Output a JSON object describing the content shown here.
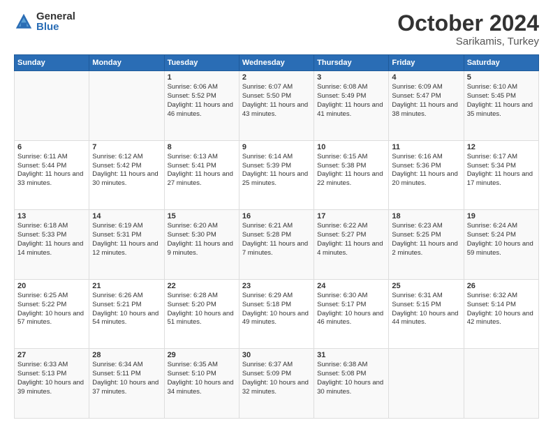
{
  "header": {
    "logo_general": "General",
    "logo_blue": "Blue",
    "title": "October 2024",
    "location": "Sarikamis, Turkey"
  },
  "calendar": {
    "days_of_week": [
      "Sunday",
      "Monday",
      "Tuesday",
      "Wednesday",
      "Thursday",
      "Friday",
      "Saturday"
    ],
    "weeks": [
      [
        {
          "day": "",
          "sunrise": "",
          "sunset": "",
          "daylight": ""
        },
        {
          "day": "",
          "sunrise": "",
          "sunset": "",
          "daylight": ""
        },
        {
          "day": "1",
          "sunrise": "Sunrise: 6:06 AM",
          "sunset": "Sunset: 5:52 PM",
          "daylight": "Daylight: 11 hours and 46 minutes."
        },
        {
          "day": "2",
          "sunrise": "Sunrise: 6:07 AM",
          "sunset": "Sunset: 5:50 PM",
          "daylight": "Daylight: 11 hours and 43 minutes."
        },
        {
          "day": "3",
          "sunrise": "Sunrise: 6:08 AM",
          "sunset": "Sunset: 5:49 PM",
          "daylight": "Daylight: 11 hours and 41 minutes."
        },
        {
          "day": "4",
          "sunrise": "Sunrise: 6:09 AM",
          "sunset": "Sunset: 5:47 PM",
          "daylight": "Daylight: 11 hours and 38 minutes."
        },
        {
          "day": "5",
          "sunrise": "Sunrise: 6:10 AM",
          "sunset": "Sunset: 5:45 PM",
          "daylight": "Daylight: 11 hours and 35 minutes."
        }
      ],
      [
        {
          "day": "6",
          "sunrise": "Sunrise: 6:11 AM",
          "sunset": "Sunset: 5:44 PM",
          "daylight": "Daylight: 11 hours and 33 minutes."
        },
        {
          "day": "7",
          "sunrise": "Sunrise: 6:12 AM",
          "sunset": "Sunset: 5:42 PM",
          "daylight": "Daylight: 11 hours and 30 minutes."
        },
        {
          "day": "8",
          "sunrise": "Sunrise: 6:13 AM",
          "sunset": "Sunset: 5:41 PM",
          "daylight": "Daylight: 11 hours and 27 minutes."
        },
        {
          "day": "9",
          "sunrise": "Sunrise: 6:14 AM",
          "sunset": "Sunset: 5:39 PM",
          "daylight": "Daylight: 11 hours and 25 minutes."
        },
        {
          "day": "10",
          "sunrise": "Sunrise: 6:15 AM",
          "sunset": "Sunset: 5:38 PM",
          "daylight": "Daylight: 11 hours and 22 minutes."
        },
        {
          "day": "11",
          "sunrise": "Sunrise: 6:16 AM",
          "sunset": "Sunset: 5:36 PM",
          "daylight": "Daylight: 11 hours and 20 minutes."
        },
        {
          "day": "12",
          "sunrise": "Sunrise: 6:17 AM",
          "sunset": "Sunset: 5:34 PM",
          "daylight": "Daylight: 11 hours and 17 minutes."
        }
      ],
      [
        {
          "day": "13",
          "sunrise": "Sunrise: 6:18 AM",
          "sunset": "Sunset: 5:33 PM",
          "daylight": "Daylight: 11 hours and 14 minutes."
        },
        {
          "day": "14",
          "sunrise": "Sunrise: 6:19 AM",
          "sunset": "Sunset: 5:31 PM",
          "daylight": "Daylight: 11 hours and 12 minutes."
        },
        {
          "day": "15",
          "sunrise": "Sunrise: 6:20 AM",
          "sunset": "Sunset: 5:30 PM",
          "daylight": "Daylight: 11 hours and 9 minutes."
        },
        {
          "day": "16",
          "sunrise": "Sunrise: 6:21 AM",
          "sunset": "Sunset: 5:28 PM",
          "daylight": "Daylight: 11 hours and 7 minutes."
        },
        {
          "day": "17",
          "sunrise": "Sunrise: 6:22 AM",
          "sunset": "Sunset: 5:27 PM",
          "daylight": "Daylight: 11 hours and 4 minutes."
        },
        {
          "day": "18",
          "sunrise": "Sunrise: 6:23 AM",
          "sunset": "Sunset: 5:25 PM",
          "daylight": "Daylight: 11 hours and 2 minutes."
        },
        {
          "day": "19",
          "sunrise": "Sunrise: 6:24 AM",
          "sunset": "Sunset: 5:24 PM",
          "daylight": "Daylight: 10 hours and 59 minutes."
        }
      ],
      [
        {
          "day": "20",
          "sunrise": "Sunrise: 6:25 AM",
          "sunset": "Sunset: 5:22 PM",
          "daylight": "Daylight: 10 hours and 57 minutes."
        },
        {
          "day": "21",
          "sunrise": "Sunrise: 6:26 AM",
          "sunset": "Sunset: 5:21 PM",
          "daylight": "Daylight: 10 hours and 54 minutes."
        },
        {
          "day": "22",
          "sunrise": "Sunrise: 6:28 AM",
          "sunset": "Sunset: 5:20 PM",
          "daylight": "Daylight: 10 hours and 51 minutes."
        },
        {
          "day": "23",
          "sunrise": "Sunrise: 6:29 AM",
          "sunset": "Sunset: 5:18 PM",
          "daylight": "Daylight: 10 hours and 49 minutes."
        },
        {
          "day": "24",
          "sunrise": "Sunrise: 6:30 AM",
          "sunset": "Sunset: 5:17 PM",
          "daylight": "Daylight: 10 hours and 46 minutes."
        },
        {
          "day": "25",
          "sunrise": "Sunrise: 6:31 AM",
          "sunset": "Sunset: 5:15 PM",
          "daylight": "Daylight: 10 hours and 44 minutes."
        },
        {
          "day": "26",
          "sunrise": "Sunrise: 6:32 AM",
          "sunset": "Sunset: 5:14 PM",
          "daylight": "Daylight: 10 hours and 42 minutes."
        }
      ],
      [
        {
          "day": "27",
          "sunrise": "Sunrise: 6:33 AM",
          "sunset": "Sunset: 5:13 PM",
          "daylight": "Daylight: 10 hours and 39 minutes."
        },
        {
          "day": "28",
          "sunrise": "Sunrise: 6:34 AM",
          "sunset": "Sunset: 5:11 PM",
          "daylight": "Daylight: 10 hours and 37 minutes."
        },
        {
          "day": "29",
          "sunrise": "Sunrise: 6:35 AM",
          "sunset": "Sunset: 5:10 PM",
          "daylight": "Daylight: 10 hours and 34 minutes."
        },
        {
          "day": "30",
          "sunrise": "Sunrise: 6:37 AM",
          "sunset": "Sunset: 5:09 PM",
          "daylight": "Daylight: 10 hours and 32 minutes."
        },
        {
          "day": "31",
          "sunrise": "Sunrise: 6:38 AM",
          "sunset": "Sunset: 5:08 PM",
          "daylight": "Daylight: 10 hours and 30 minutes."
        },
        {
          "day": "",
          "sunrise": "",
          "sunset": "",
          "daylight": ""
        },
        {
          "day": "",
          "sunrise": "",
          "sunset": "",
          "daylight": ""
        }
      ]
    ]
  }
}
